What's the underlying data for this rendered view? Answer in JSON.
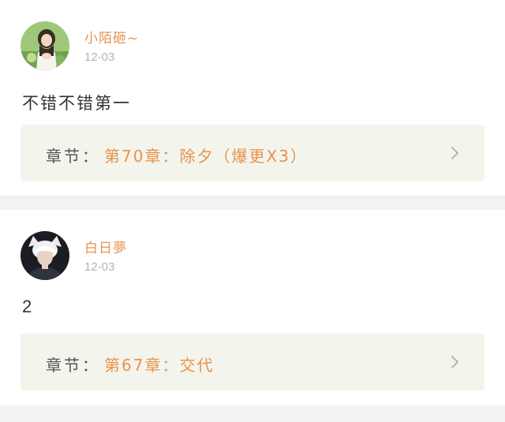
{
  "comments": [
    {
      "username": "小陌砸~",
      "date": "12-03",
      "content": "不错不错第一",
      "chapter_prefix": "章节：",
      "chapter_title": "第70章：除夕（爆更X3）",
      "avatar_icon": "avatar-girl-icon"
    },
    {
      "username": "白日夢",
      "date": "12-03",
      "content": "2",
      "chapter_prefix": "章节：",
      "chapter_title": "第67章：交代",
      "avatar_icon": "avatar-boy-icon"
    }
  ],
  "colors": {
    "accent": "#e8924b",
    "chapter_bg": "#f3f5ec",
    "date_gray": "#b3b3b3",
    "page_bg": "#f2f2f2"
  }
}
